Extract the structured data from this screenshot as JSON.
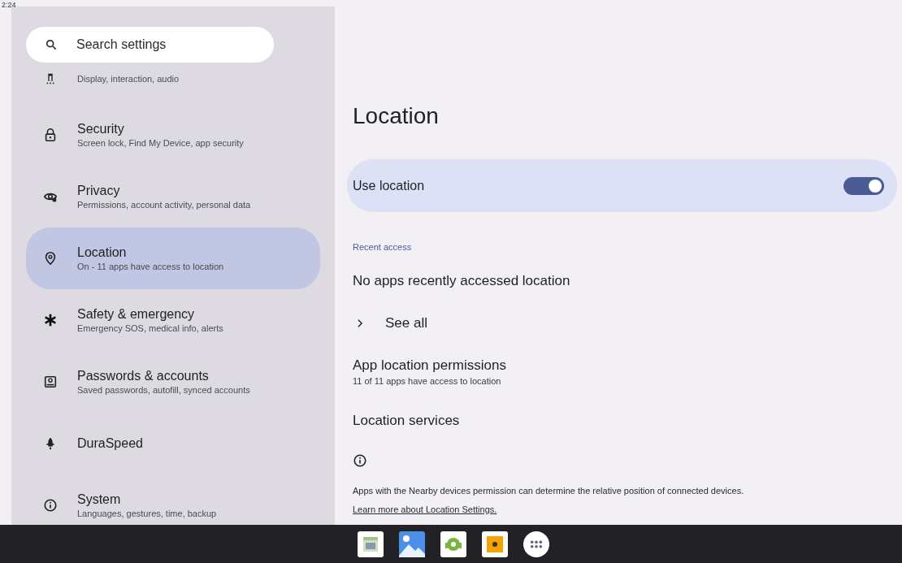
{
  "status_bar": {
    "time": "2:24"
  },
  "search": {
    "placeholder": "Search settings"
  },
  "sidebar": {
    "items": [
      {
        "subtitle": "Display, interaction, audio",
        "selected": false
      },
      {
        "title": "Security",
        "subtitle": "Screen lock, Find My Device, app security",
        "selected": false
      },
      {
        "title": "Privacy",
        "subtitle": "Permissions, account activity, personal data",
        "selected": false
      },
      {
        "title": "Location",
        "subtitle": "On - 11 apps have access to location",
        "selected": true
      },
      {
        "title": "Safety & emergency",
        "subtitle": "Emergency SOS, medical info, alerts",
        "selected": false
      },
      {
        "title": "Passwords & accounts",
        "subtitle": "Saved passwords, autofill, synced accounts",
        "selected": false
      },
      {
        "title": "DuraSpeed",
        "selected": false
      },
      {
        "title": "System",
        "subtitle": "Languages, gestures, time, backup",
        "selected": false
      }
    ]
  },
  "page": {
    "title": "Location",
    "main_switch": {
      "label": "Use location",
      "on": true
    },
    "section_header": "Recent access",
    "recent_text": "No apps recently accessed location",
    "see_all": "See all",
    "app_permissions": {
      "title": "App location permissions",
      "subtitle": "11 of 11 apps have access to location"
    },
    "location_services": "Location services",
    "footer_text": "Apps with the Nearby devices permission can determine the relative position of connected devices.",
    "footer_link": "Learn more about Location Settings."
  }
}
